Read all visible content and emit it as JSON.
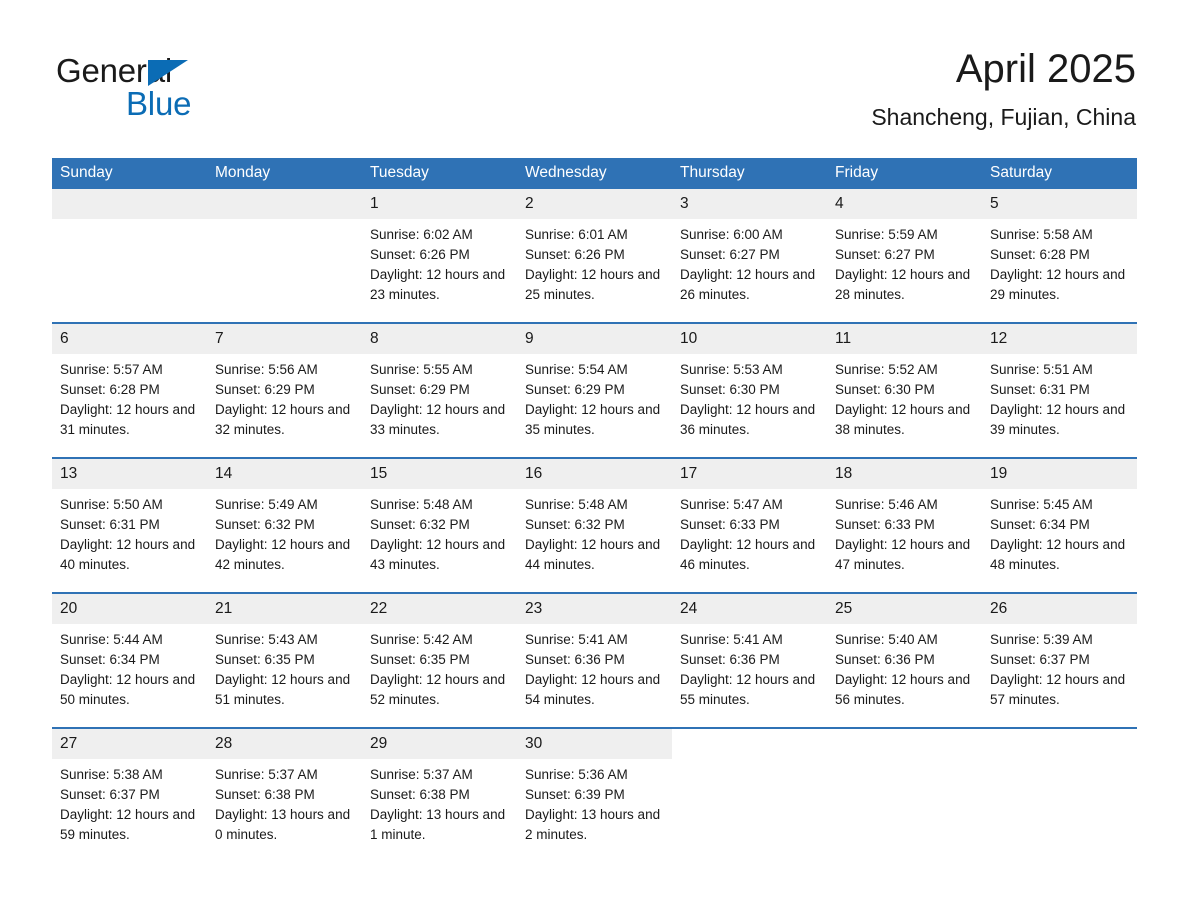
{
  "brand": {
    "word_one": "General",
    "word_two": "Blue",
    "triangle_icon": "triangle-icon",
    "accent_color": "#0b6cb5"
  },
  "header": {
    "title": "April 2025",
    "subtitle": "Shancheng, Fujian, China"
  },
  "theme": {
    "header_blue": "#2f72b5",
    "row_divider_blue": "#2f72b5",
    "daynum_gray": "#efefef"
  },
  "weekday_headers": [
    "Sunday",
    "Monday",
    "Tuesday",
    "Wednesday",
    "Thursday",
    "Friday",
    "Saturday"
  ],
  "weeks": [
    [
      {
        "day": "",
        "empty": true
      },
      {
        "day": "",
        "empty": true
      },
      {
        "day": "1",
        "sunrise": "Sunrise: 6:02 AM",
        "sunset": "Sunset: 6:26 PM",
        "daylight": "Daylight: 12 hours and 23 minutes."
      },
      {
        "day": "2",
        "sunrise": "Sunrise: 6:01 AM",
        "sunset": "Sunset: 6:26 PM",
        "daylight": "Daylight: 12 hours and 25 minutes."
      },
      {
        "day": "3",
        "sunrise": "Sunrise: 6:00 AM",
        "sunset": "Sunset: 6:27 PM",
        "daylight": "Daylight: 12 hours and 26 minutes."
      },
      {
        "day": "4",
        "sunrise": "Sunrise: 5:59 AM",
        "sunset": "Sunset: 6:27 PM",
        "daylight": "Daylight: 12 hours and 28 minutes."
      },
      {
        "day": "5",
        "sunrise": "Sunrise: 5:58 AM",
        "sunset": "Sunset: 6:28 PM",
        "daylight": "Daylight: 12 hours and 29 minutes."
      }
    ],
    [
      {
        "day": "6",
        "sunrise": "Sunrise: 5:57 AM",
        "sunset": "Sunset: 6:28 PM",
        "daylight": "Daylight: 12 hours and 31 minutes."
      },
      {
        "day": "7",
        "sunrise": "Sunrise: 5:56 AM",
        "sunset": "Sunset: 6:29 PM",
        "daylight": "Daylight: 12 hours and 32 minutes."
      },
      {
        "day": "8",
        "sunrise": "Sunrise: 5:55 AM",
        "sunset": "Sunset: 6:29 PM",
        "daylight": "Daylight: 12 hours and 33 minutes."
      },
      {
        "day": "9",
        "sunrise": "Sunrise: 5:54 AM",
        "sunset": "Sunset: 6:29 PM",
        "daylight": "Daylight: 12 hours and 35 minutes."
      },
      {
        "day": "10",
        "sunrise": "Sunrise: 5:53 AM",
        "sunset": "Sunset: 6:30 PM",
        "daylight": "Daylight: 12 hours and 36 minutes."
      },
      {
        "day": "11",
        "sunrise": "Sunrise: 5:52 AM",
        "sunset": "Sunset: 6:30 PM",
        "daylight": "Daylight: 12 hours and 38 minutes."
      },
      {
        "day": "12",
        "sunrise": "Sunrise: 5:51 AM",
        "sunset": "Sunset: 6:31 PM",
        "daylight": "Daylight: 12 hours and 39 minutes."
      }
    ],
    [
      {
        "day": "13",
        "sunrise": "Sunrise: 5:50 AM",
        "sunset": "Sunset: 6:31 PM",
        "daylight": "Daylight: 12 hours and 40 minutes."
      },
      {
        "day": "14",
        "sunrise": "Sunrise: 5:49 AM",
        "sunset": "Sunset: 6:32 PM",
        "daylight": "Daylight: 12 hours and 42 minutes."
      },
      {
        "day": "15",
        "sunrise": "Sunrise: 5:48 AM",
        "sunset": "Sunset: 6:32 PM",
        "daylight": "Daylight: 12 hours and 43 minutes."
      },
      {
        "day": "16",
        "sunrise": "Sunrise: 5:48 AM",
        "sunset": "Sunset: 6:32 PM",
        "daylight": "Daylight: 12 hours and 44 minutes."
      },
      {
        "day": "17",
        "sunrise": "Sunrise: 5:47 AM",
        "sunset": "Sunset: 6:33 PM",
        "daylight": "Daylight: 12 hours and 46 minutes."
      },
      {
        "day": "18",
        "sunrise": "Sunrise: 5:46 AM",
        "sunset": "Sunset: 6:33 PM",
        "daylight": "Daylight: 12 hours and 47 minutes."
      },
      {
        "day": "19",
        "sunrise": "Sunrise: 5:45 AM",
        "sunset": "Sunset: 6:34 PM",
        "daylight": "Daylight: 12 hours and 48 minutes."
      }
    ],
    [
      {
        "day": "20",
        "sunrise": "Sunrise: 5:44 AM",
        "sunset": "Sunset: 6:34 PM",
        "daylight": "Daylight: 12 hours and 50 minutes."
      },
      {
        "day": "21",
        "sunrise": "Sunrise: 5:43 AM",
        "sunset": "Sunset: 6:35 PM",
        "daylight": "Daylight: 12 hours and 51 minutes."
      },
      {
        "day": "22",
        "sunrise": "Sunrise: 5:42 AM",
        "sunset": "Sunset: 6:35 PM",
        "daylight": "Daylight: 12 hours and 52 minutes."
      },
      {
        "day": "23",
        "sunrise": "Sunrise: 5:41 AM",
        "sunset": "Sunset: 6:36 PM",
        "daylight": "Daylight: 12 hours and 54 minutes."
      },
      {
        "day": "24",
        "sunrise": "Sunrise: 5:41 AM",
        "sunset": "Sunset: 6:36 PM",
        "daylight": "Daylight: 12 hours and 55 minutes."
      },
      {
        "day": "25",
        "sunrise": "Sunrise: 5:40 AM",
        "sunset": "Sunset: 6:36 PM",
        "daylight": "Daylight: 12 hours and 56 minutes."
      },
      {
        "day": "26",
        "sunrise": "Sunrise: 5:39 AM",
        "sunset": "Sunset: 6:37 PM",
        "daylight": "Daylight: 12 hours and 57 minutes."
      }
    ],
    [
      {
        "day": "27",
        "sunrise": "Sunrise: 5:38 AM",
        "sunset": "Sunset: 6:37 PM",
        "daylight": "Daylight: 12 hours and 59 minutes."
      },
      {
        "day": "28",
        "sunrise": "Sunrise: 5:37 AM",
        "sunset": "Sunset: 6:38 PM",
        "daylight": "Daylight: 13 hours and 0 minutes."
      },
      {
        "day": "29",
        "sunrise": "Sunrise: 5:37 AM",
        "sunset": "Sunset: 6:38 PM",
        "daylight": "Daylight: 13 hours and 1 minute."
      },
      {
        "day": "30",
        "sunrise": "Sunrise: 5:36 AM",
        "sunset": "Sunset: 6:39 PM",
        "daylight": "Daylight: 13 hours and 2 minutes."
      },
      {
        "day": "",
        "empty": true,
        "trailing": true
      },
      {
        "day": "",
        "empty": true,
        "trailing": true
      },
      {
        "day": "",
        "empty": true,
        "trailing": true
      }
    ]
  ]
}
